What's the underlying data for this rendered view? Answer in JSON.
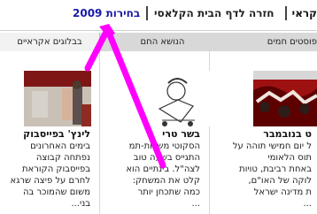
{
  "nav": {
    "current_link": "בחירות 2009",
    "home_link": "חזרה לדף הבית הקלאסי",
    "left_partial": "קראי"
  },
  "tabs": {
    "left": "בבלוגים אקראיים",
    "middle": "הנושא החם",
    "right": "פוסטים חמים"
  },
  "articles": [
    {
      "title": "לינץ' בפייסבוק",
      "lines": [
        "בימים האחרונים",
        "נפתחה קבוצה",
        "בפייסבוק הקוראת",
        "לחרם על פיצה שרגא",
        "משום שהמוכר בה",
        "בני..."
      ]
    },
    {
      "title": "בשר טרי",
      "lines": [
        "הסקוטי משדות-תמ",
        "התגייס בשעה טוב",
        "לצה\"ל. בינתיים הוא",
        "קלט את המשחק:",
        "כמה שתכחן יותר",
        "..."
      ]
    },
    {
      "title": "ט בנובמבר",
      "lines": [
        "ל יום חמישי תוהה על",
        "תוס הלאומי",
        "באחת רביבת, טויות",
        "לוקה של האו\"ם,",
        "ת מדינה ישראל",
        "..."
      ]
    }
  ],
  "annotation": {
    "color": "#ff00ff"
  }
}
